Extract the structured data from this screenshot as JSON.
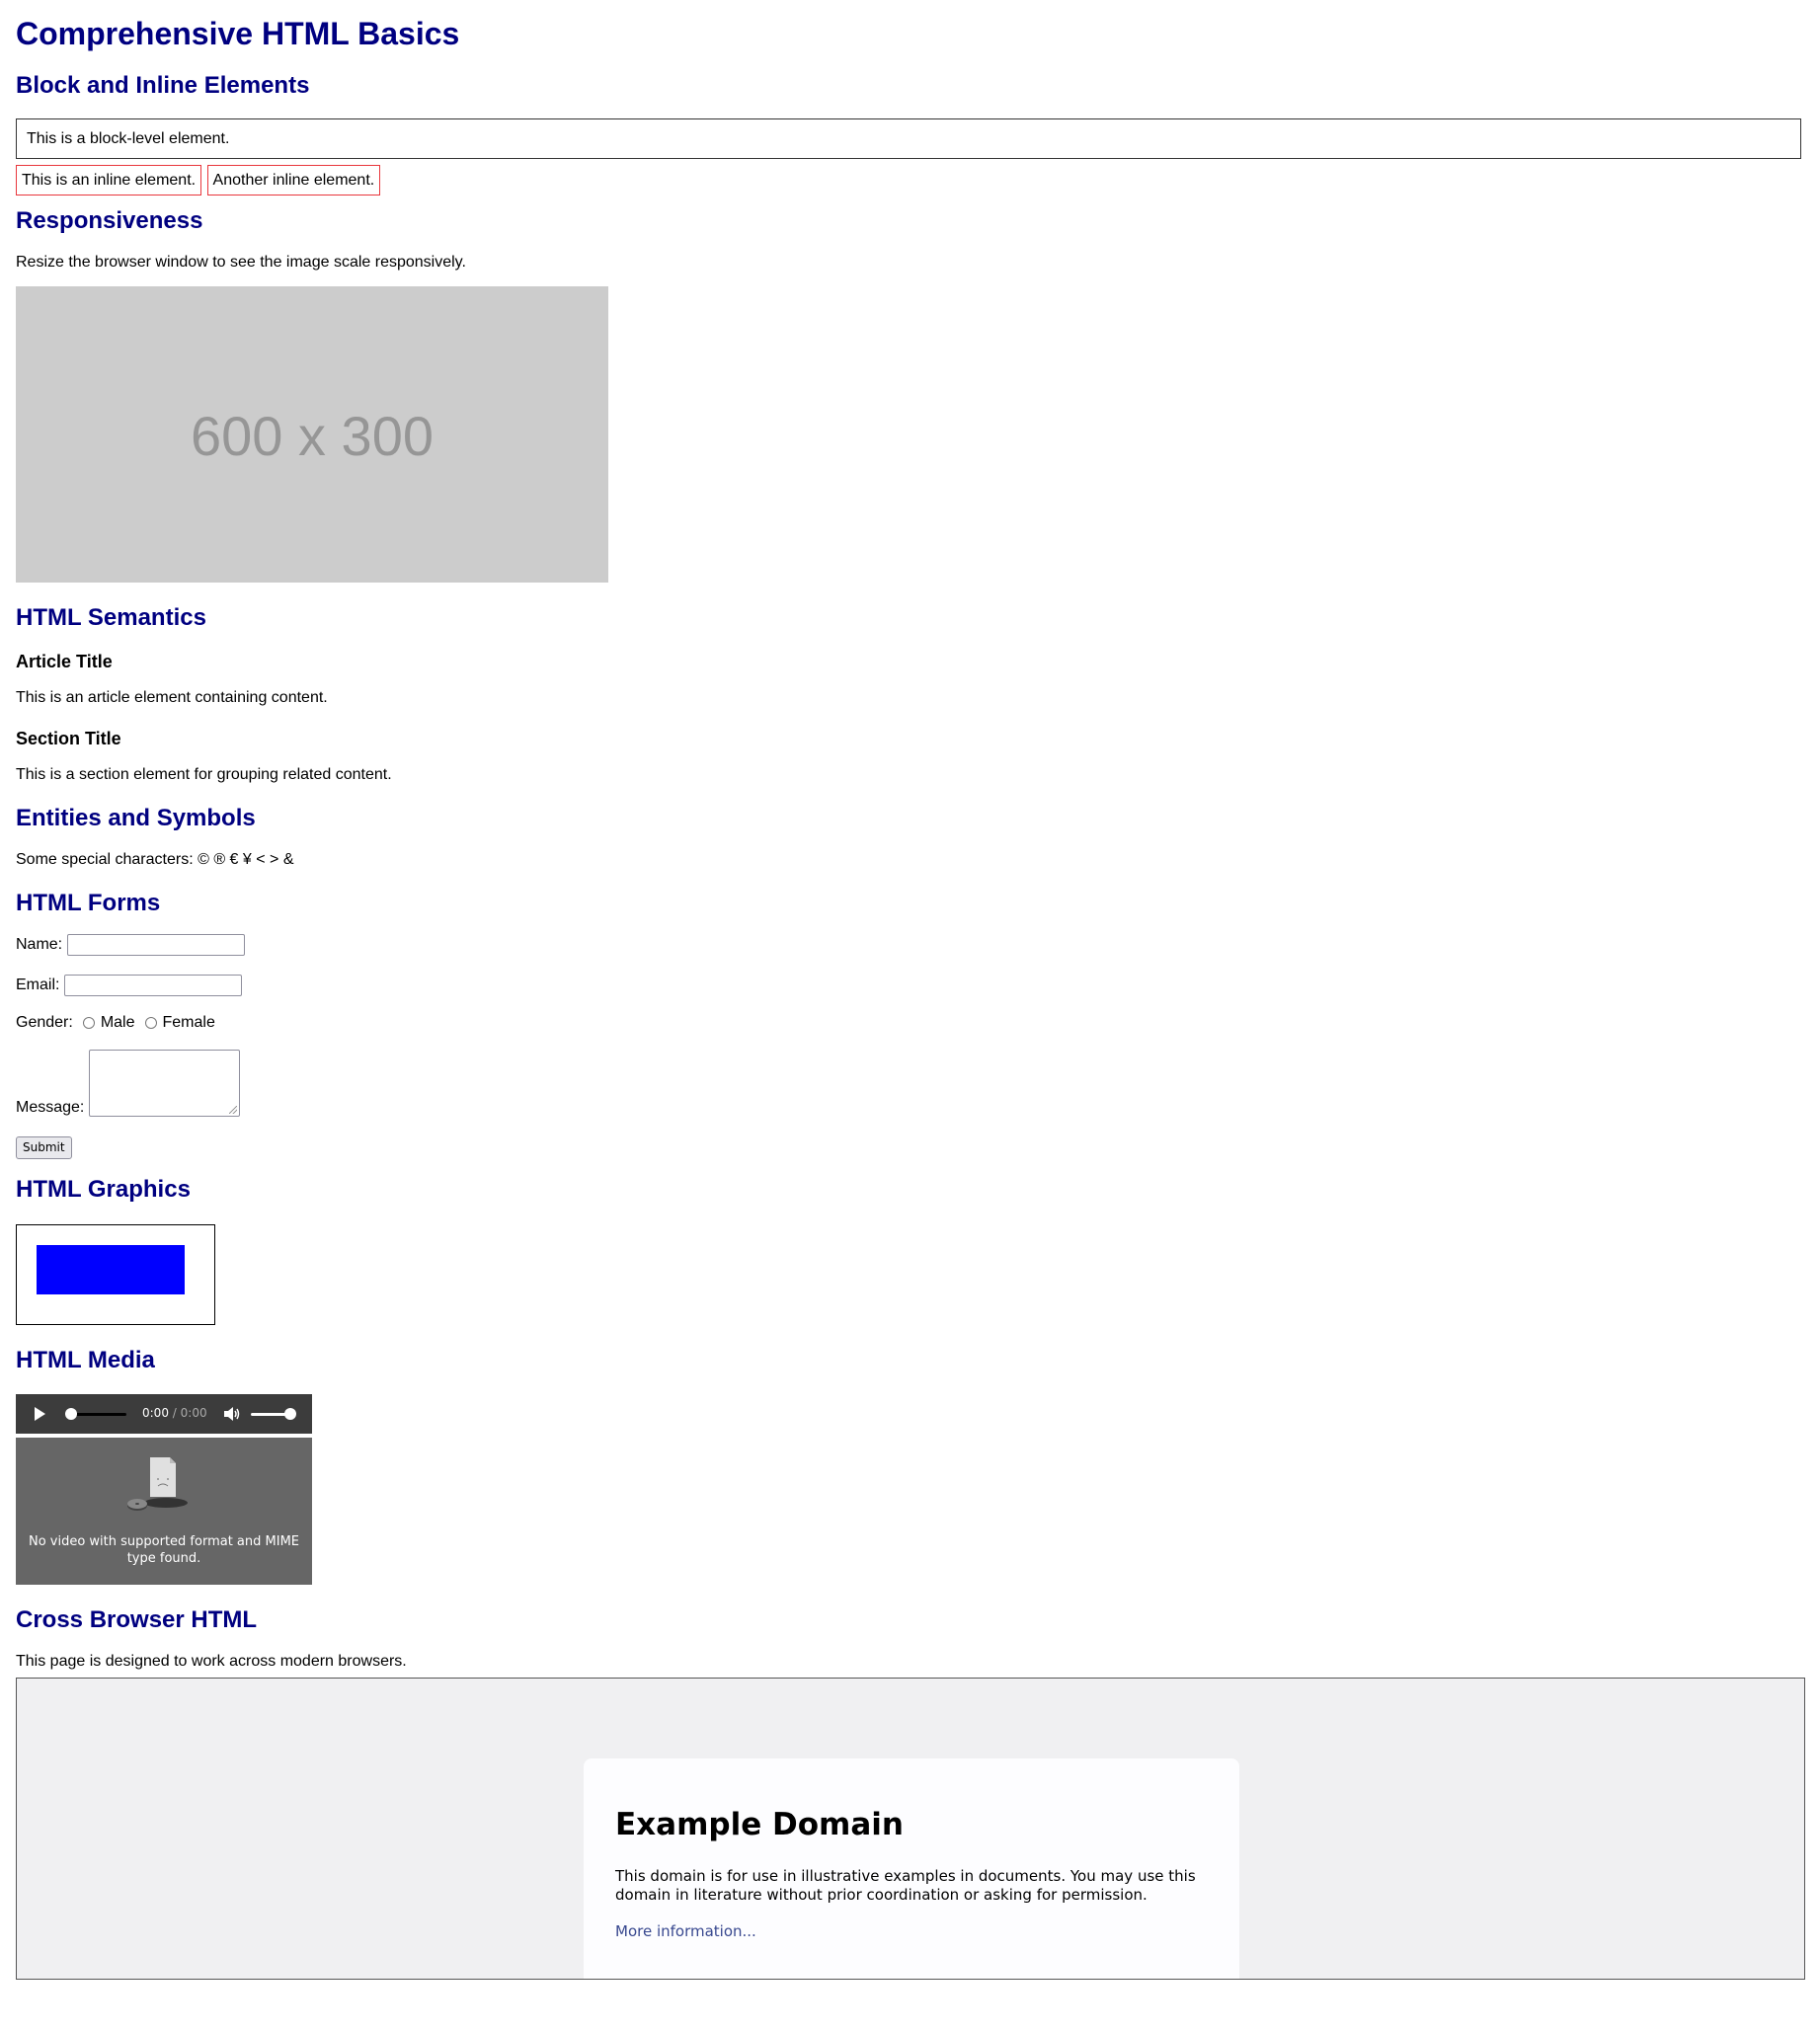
{
  "page_title": "Comprehensive HTML Basics",
  "sections": {
    "block_inline": {
      "heading": "Block and Inline Elements",
      "block_text": "This is a block-level element.",
      "inline_1": "This is an inline element.",
      "inline_2": "Another inline element."
    },
    "responsiveness": {
      "heading": "Responsiveness",
      "text": "Resize the browser window to see the image scale responsively.",
      "image_label": "600 x 300"
    },
    "semantics": {
      "heading": "HTML Semantics",
      "article_title": "Article Title",
      "article_text": "This is an article element containing content.",
      "section_title": "Section Title",
      "section_text": "This is a section element for grouping related content."
    },
    "entities": {
      "heading": "Entities and Symbols",
      "text": "Some special characters: © ® € ¥ < > &"
    },
    "forms": {
      "heading": "HTML Forms",
      "name_label": "Name:",
      "name_value": "",
      "email_label": "Email:",
      "email_value": "",
      "gender_label": "Gender:",
      "gender_options": [
        "Male",
        "Female"
      ],
      "message_label": "Message:",
      "message_value": "",
      "submit_label": "Submit"
    },
    "graphics": {
      "heading": "HTML Graphics",
      "rect_color": "#0000ff"
    },
    "media": {
      "heading": "HTML Media",
      "audio_time": "0:00",
      "audio_duration": "/ 0:00",
      "video_message": "No video with supported format and MIME type found."
    },
    "cross_browser": {
      "heading": "Cross Browser HTML",
      "text": "This page is designed to work across modern browsers.",
      "iframe": {
        "title": "Example Domain",
        "text": "This domain is for use in illustrative examples in documents. You may use this domain in literature without prior coordination or asking for permission.",
        "link": "More information..."
      }
    }
  },
  "colors": {
    "heading": "#000080",
    "inline_border": "#e8363c",
    "placeholder_bg": "#cccccc",
    "iframe_link": "#38488f"
  }
}
